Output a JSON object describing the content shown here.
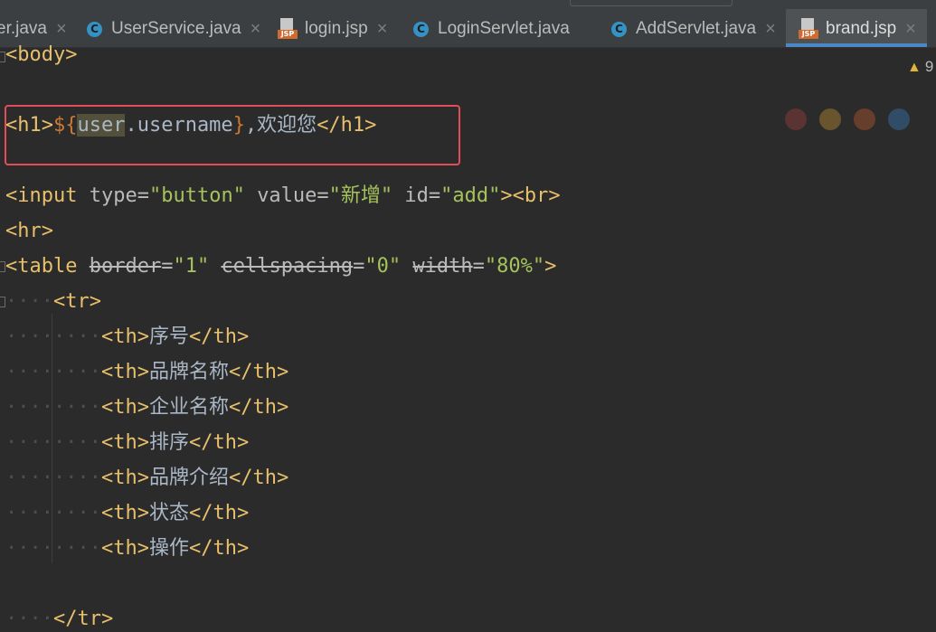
{
  "tabs": [
    {
      "label": "er.java",
      "icon": "none"
    },
    {
      "label": "UserService.java",
      "icon": "c-class-icon"
    },
    {
      "label": "login.jsp",
      "icon": "jsp-icon"
    },
    {
      "label": "LoginServlet.java",
      "icon": "c-class-icon"
    },
    {
      "label": "AddServlet.java",
      "icon": "c-class-icon"
    },
    {
      "label": "brand.jsp",
      "icon": "jsp-icon",
      "active": true
    }
  ],
  "icons": {
    "class": "C",
    "jsp": "JSP",
    "close": "×",
    "warning": "▲"
  },
  "warnings": {
    "count": "9"
  },
  "code": {
    "body_open": "<body>",
    "h1_open": "<h1>",
    "el_open": "${",
    "el_obj": "user",
    "el_prop": ".username",
    "el_close": "}",
    "h1_text": ",欢迎您",
    "h1_close": "</h1>",
    "input_tag": "<input",
    "input_attr1": "type=",
    "input_val1": "\"button\"",
    "input_attr2": "value=",
    "input_val2": "\"新增\"",
    "input_attr3": "id=",
    "input_val3": "\"add\"",
    "input_close": "><br>",
    "hr": "<hr>",
    "table_tag": "<table",
    "table_attr1": "border",
    "table_eq1": "=",
    "table_val1": "\"1\"",
    "table_attr2": "cellspacing",
    "table_eq2": "=",
    "table_val2": "\"0\"",
    "table_attr3": "width",
    "table_eq3": "=",
    "table_val3": "\"80%\"",
    "table_close": ">",
    "tr_open": "<tr>",
    "tr_close": "</tr>",
    "th_open": "<th>",
    "th_close": "</th>",
    "headers": [
      "序号",
      "品牌名称",
      "企业名称",
      "排序",
      "品牌介绍",
      "状态",
      "操作"
    ]
  },
  "colors": {
    "accent": "#4a88c7",
    "highlight_border": "#e34d5a"
  }
}
